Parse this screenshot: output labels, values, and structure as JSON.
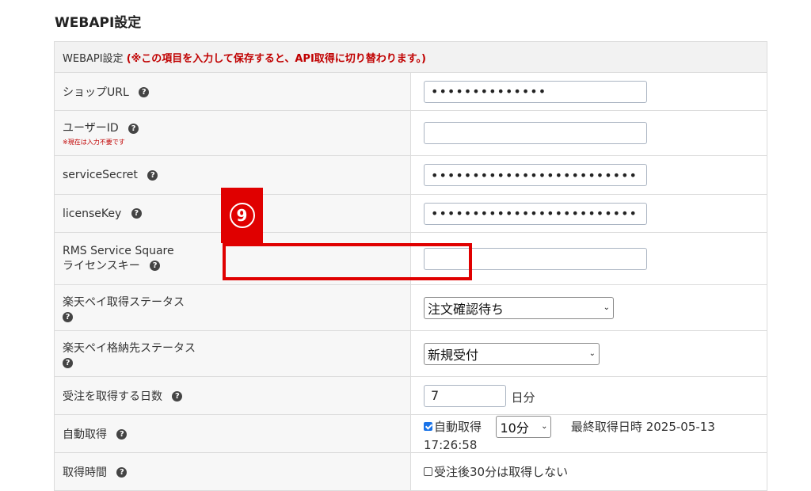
{
  "page_title": "WEBAPI設定",
  "header": {
    "label": "WEBAPI設定",
    "note": "(※この項目を入力して保存すると、API取得に切り替わります。)"
  },
  "help_icon_glyph": "?",
  "rows": {
    "shop_url": {
      "label": "ショップURL",
      "value": "••••••••••••••"
    },
    "user_id": {
      "label": "ユーザーID",
      "note": "※現在は入力不要です",
      "value": ""
    },
    "service_secret": {
      "label": "serviceSecret",
      "value": "•••••••••••••••••••••••••"
    },
    "license_key": {
      "label": "licenseKey",
      "value": "•••••••••••••••••••••••••"
    },
    "rms_key": {
      "label_line1": "RMS Service Square",
      "label_line2": "ライセンスキー",
      "value": ""
    },
    "pay_status": {
      "label": "楽天ペイ取得ステータス",
      "selected": "注文確認待ち"
    },
    "pay_dest_status": {
      "label": "楽天ペイ格納先ステータス",
      "selected": "新規受付"
    },
    "fetch_days": {
      "label": "受注を取得する日数",
      "value": "7",
      "unit": "日分"
    },
    "auto_fetch": {
      "label": "自動取得",
      "checkbox_label": "自動取得",
      "checked": true,
      "interval": "10分",
      "last_fetch": "最終取得日時 2025-05-13 17:26:58"
    },
    "fetch_time": {
      "label": "取得時間",
      "checkbox_label": "受注後30分は取得しない",
      "checked": false
    }
  },
  "annotation": {
    "number": "9",
    "color": "#e00000"
  }
}
